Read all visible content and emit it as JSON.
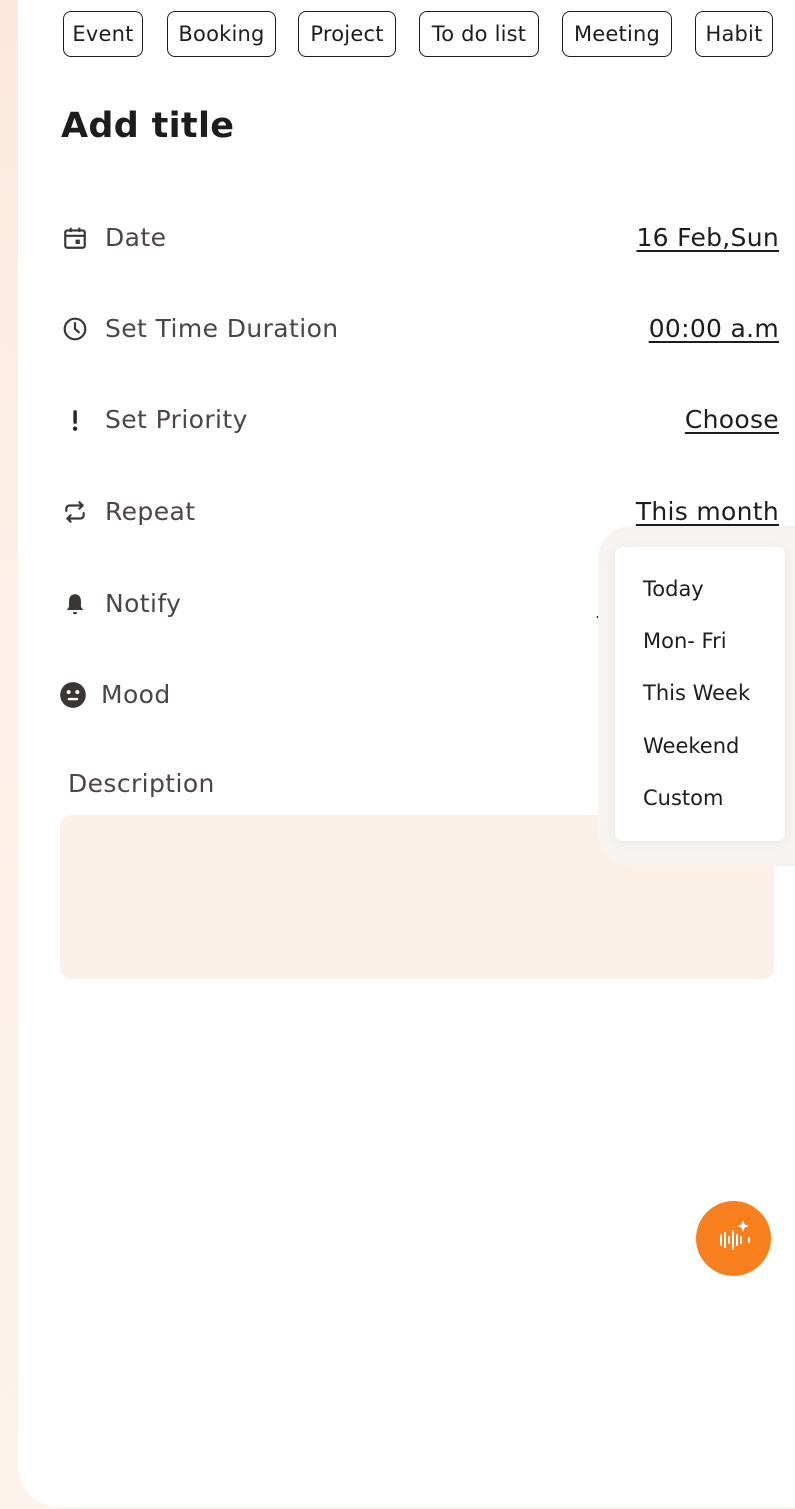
{
  "tabs": [
    "Event",
    "Booking",
    "Project",
    "To do list",
    "Meeting",
    "Habit"
  ],
  "title": "Add title",
  "rows": {
    "date": {
      "label": "Date",
      "value": "16 Feb,Sun",
      "icon": "calendar-icon"
    },
    "time": {
      "label": "Set Time Duration",
      "value": "00:00 a.m",
      "icon": "clock-icon"
    },
    "priority": {
      "label": "Set Priority",
      "value": "Choose",
      "icon": "exclamation-icon"
    },
    "repeat": {
      "label": "Repeat",
      "value": "This month",
      "icon": "repeat-icon"
    },
    "notify": {
      "label": "Notify",
      "value": "5",
      "icon": "bell-icon"
    },
    "mood": {
      "label": "Mood",
      "value": "",
      "icon": "neutral-face-icon"
    }
  },
  "description": {
    "label": "Description"
  },
  "repeat_dropdown": {
    "options": [
      "Today",
      "Mon- Fri",
      "This Week",
      "Weekend",
      "Custom"
    ]
  },
  "fab": {
    "icon": "voice-sparkle-icon"
  },
  "colors": {
    "accent": "#f77f1e",
    "text": "#1d1d1d",
    "label": "#4d4545",
    "description_box": "#fbf0e7",
    "background": "#fde8dc"
  }
}
